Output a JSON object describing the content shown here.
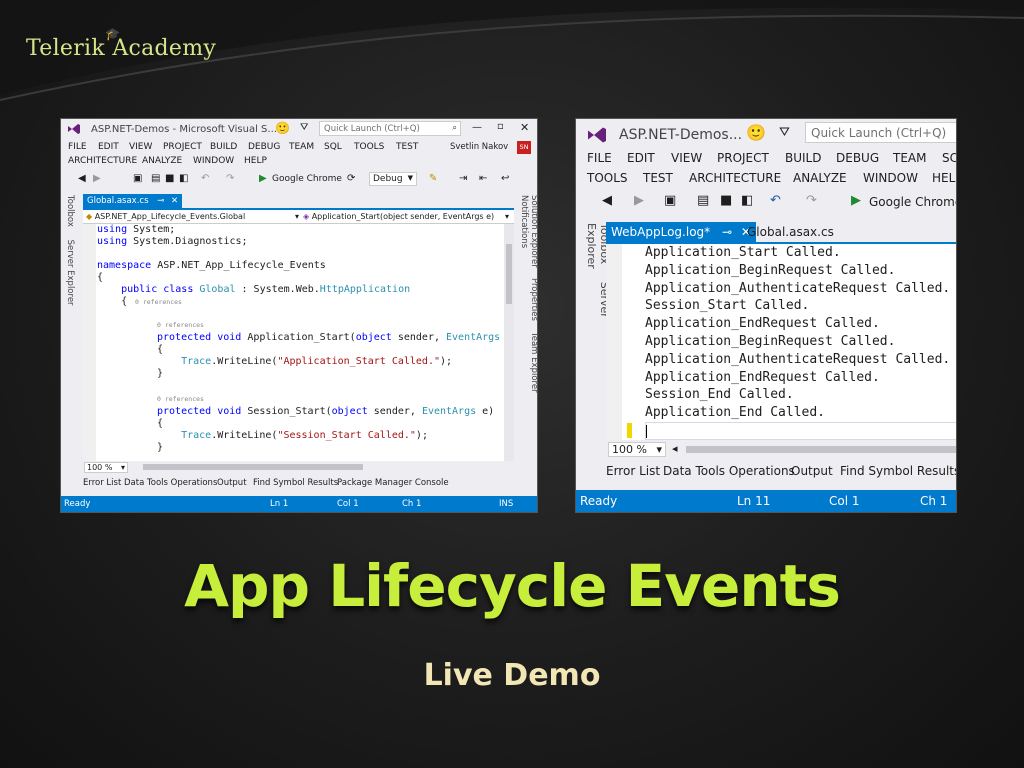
{
  "brand": {
    "logo_text": "Telerik Academy"
  },
  "slide": {
    "title": "App Lifecycle Events",
    "subtitle": "Live Demo"
  },
  "colors": {
    "accent_title": "#c7ee3a",
    "subtitle": "#f3e6b5",
    "vs_blue": "#007acc",
    "vs_purple": "#68217a"
  },
  "left_window": {
    "title": "ASP.NET-Demos - Microsoft Visual S...",
    "quick_launch_placeholder": "Quick Launch (Ctrl+Q)",
    "user": "Svetlin Nakov",
    "user_badge": "SN",
    "menu_row1": [
      "FILE",
      "EDIT",
      "VIEW",
      "PROJECT",
      "BUILD",
      "DEBUG",
      "TEAM",
      "SQL",
      "TOOLS",
      "TEST"
    ],
    "menu_row2": [
      "ARCHITECTURE",
      "ANALYZE",
      "WINDOW",
      "HELP"
    ],
    "toolbar": {
      "run_target": "Google Chrome",
      "config": "Debug"
    },
    "left_sidebar": [
      "Toolbox",
      "Server Explorer"
    ],
    "right_sidebar": [
      "Solution Explorer",
      "Properties",
      "Team Explorer",
      "Notifications"
    ],
    "active_tab": "Global.asax.cs",
    "nav_left": "ASP.NET_App_Lifecycle_Events.Global",
    "nav_right": "Application_Start(object sender, EventArgs e)",
    "code": {
      "line1": "using System;",
      "line2": "using System.Diagnostics;",
      "ns_kw": "namespace",
      "ns_name": "ASP.NET_App_Lifecycle_Events",
      "brace_open": "{",
      "brace_close": "}",
      "class_mods": "public class",
      "class_name": "Global",
      "class_sep": " : System.Web.",
      "class_base": "HttpApplication",
      "refs": "0 references",
      "protected_void": "protected void",
      "method1": "Application_Start(",
      "method2": "Session_Start(",
      "object_kw": "object",
      "sender": " sender, ",
      "eventargs": "EventArgs",
      "e": " e)",
      "trace": "Trace",
      "writeline": ".WriteLine(",
      "str1": "\"Application_Start Called.\"",
      "str2": "\"Session_Start Called.\"",
      "end": ");"
    },
    "zoom": "100 %",
    "panel_tabs": [
      "Error List",
      "Data Tools Operations",
      "Output",
      "Find Symbol Results",
      "Package Manager Console"
    ],
    "status": {
      "ready": "Ready",
      "ln": "Ln 1",
      "col": "Col 1",
      "ch": "Ch 1",
      "mode": "INS"
    }
  },
  "right_window": {
    "title": "ASP.NET-Demos...",
    "quick_launch_placeholder": "Quick Launch (Ctrl+Q)",
    "menu_row1": [
      "FILE",
      "EDIT",
      "VIEW",
      "PROJECT",
      "BUILD",
      "DEBUG",
      "TEAM",
      "SC"
    ],
    "menu_row2": [
      "TOOLS",
      "TEST",
      "ARCHITECTURE",
      "ANALYZE",
      "WINDOW",
      "HELP"
    ],
    "toolbar": {
      "run_target": "Google Chrome"
    },
    "left_sidebar": [
      "Toolbox",
      "Server Explorer"
    ],
    "active_tab": "WebAppLog.log*",
    "tab2": "Global.asax.cs",
    "log_lines": [
      "Application_Start Called.",
      "Application_BeginRequest Called.",
      "Application_AuthenticateRequest Called.",
      "Session_Start Called.",
      "Application_EndRequest Called.",
      "Application_BeginRequest Called.",
      "Application_AuthenticateRequest Called.",
      "Application_EndRequest Called.",
      "Session_End Called.",
      "Application_End Called."
    ],
    "zoom": "100 %",
    "panel_tabs": [
      "Error List",
      "Data Tools Operations",
      "Output",
      "Find Symbol Results"
    ],
    "status": {
      "ready": "Ready",
      "ln": "Ln 11",
      "col": "Col 1",
      "ch": "Ch 1"
    }
  }
}
